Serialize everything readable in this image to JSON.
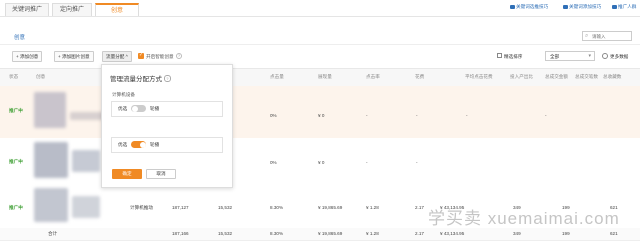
{
  "tabs": [
    "关键词推广",
    "定向推广",
    "创意"
  ],
  "top_links": [
    "关键词选推技巧",
    "关键词添加技巧",
    "推广人群"
  ],
  "section_title": "创意",
  "search": {
    "placeholder": "请输入"
  },
  "toolbar": {
    "add_creative": "添加创意",
    "add_copy": "添加图片创意",
    "traffic_dist": "流量分配",
    "smart_label": "开启智能创意",
    "sort_label": "精选排序",
    "sort_value": "全部",
    "more_data": "更多数据"
  },
  "columns": [
    "状态",
    "创意",
    "",
    "点击量",
    "展现量",
    "点击率",
    "花费",
    "平均点击花费",
    "投入产出比",
    "总成交金额",
    "总成交笔数",
    "总收藏数",
    "总购物车数"
  ],
  "rows": [
    {
      "status": "推广中",
      "ctr": "0%",
      "cost": "¥ 0",
      "dash": "-"
    },
    {
      "status": "推广中",
      "ctr": "0%",
      "cost": "¥ 0",
      "dash": "-"
    },
    {
      "status": "推广中",
      "name": "计算机推动",
      "c1": "187,127",
      "c2": "15,532",
      "ctr": "8.30%",
      "cost": "¥ 19,865.69",
      "cpc": "¥ 1.28",
      "roi": "2.17",
      "gmv": "¥ 43,134.95",
      "orders": "349",
      "fav": "199",
      "cart": "621"
    }
  ],
  "total": {
    "label": "合计",
    "c1": "187,166",
    "c2": "15,532",
    "ctr": "8.30%",
    "cost": "¥ 19,865.69",
    "cpc": "¥ 1.28",
    "roi": "2.17",
    "gmv": "¥ 43,134.95",
    "orders": "349",
    "fav": "199",
    "cart": "621"
  },
  "popup": {
    "title": "管理流量分配方式",
    "opt1_label": "计算机设备",
    "opt_left": "优选",
    "opt_right": "轮播",
    "confirm": "确定",
    "cancel": "取消"
  },
  "watermark": "学买卖 xuemaimai.com",
  "colors": {
    "accent": "#f08a24",
    "status": "#3a9d2f",
    "link": "#2f6fb7"
  }
}
